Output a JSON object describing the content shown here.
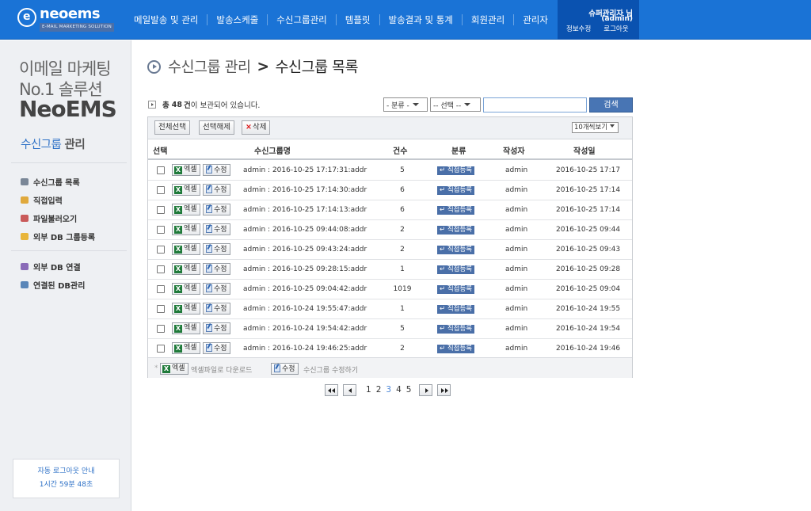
{
  "header": {
    "logo_name": "neoems",
    "logo_tagline": "E-MAIL MARKETING SOLUTION",
    "nav": [
      "메일발송 및 관리",
      "발송스케줄",
      "수신그룹관리",
      "템플릿",
      "발송결과 및 통계",
      "회원관리",
      "관리자"
    ],
    "user_name": "슈퍼관리자 님",
    "user_id": "(admin)",
    "edit_info": "정보수정",
    "logout": "로그아웃"
  },
  "sidebar": {
    "brand_line1": "이메일 마케팅",
    "brand_line2": "No.1 솔루션",
    "brand_line3": "NeoEMS",
    "section_title_a": "수신그룹",
    "section_title_b": "관리",
    "menu": [
      "수신그룹 목록",
      "직접입력",
      "파일불러오기",
      "외부 DB 그룹등록",
      "외부 DB 연결",
      "연결된 DB관리"
    ],
    "auto_logout_title": "자동 로그아웃 안내",
    "auto_logout_time": "1시간 59분 48초"
  },
  "breadcrumb": {
    "parent": "수신그룹 관리",
    "separator": ">",
    "current": "수신그룹 목록"
  },
  "summary": {
    "prefix": "총",
    "count": "48",
    "unit": "건",
    "suffix": "이 보관되어 있습니다."
  },
  "filters": {
    "category_select": "- 분류 -",
    "option_select": "-- 선택 --",
    "search_value": "",
    "search_button": "검색"
  },
  "toolbar": {
    "select_all": "전체선택",
    "deselect": "선택해제",
    "delete": "삭제",
    "page_size": "10개씩보기"
  },
  "table": {
    "headers": [
      "선택",
      "수신그룹명",
      "건수",
      "분류",
      "작성자",
      "작성일"
    ],
    "excel_label": "엑셀",
    "edit_label": "수정",
    "rows": [
      {
        "name": "admin : 2016-10-25 17:17:31:addr",
        "count": "5",
        "category": "직접등록",
        "author": "admin",
        "date": "2016-10-25 17:17"
      },
      {
        "name": "admin : 2016-10-25 17:14:30:addr",
        "count": "6",
        "category": "직접등록",
        "author": "admin",
        "date": "2016-10-25 17:14"
      },
      {
        "name": "admin : 2016-10-25 17:14:13:addr",
        "count": "6",
        "category": "직접등록",
        "author": "admin",
        "date": "2016-10-25 17:14"
      },
      {
        "name": "admin : 2016-10-25 09:44:08:addr",
        "count": "2",
        "category": "직접등록",
        "author": "admin",
        "date": "2016-10-25 09:44"
      },
      {
        "name": "admin : 2016-10-25 09:43:24:addr",
        "count": "2",
        "category": "직접등록",
        "author": "admin",
        "date": "2016-10-25 09:43"
      },
      {
        "name": "admin : 2016-10-25 09:28:15:addr",
        "count": "1",
        "category": "직접등록",
        "author": "admin",
        "date": "2016-10-25 09:28"
      },
      {
        "name": "admin : 2016-10-25 09:04:42:addr",
        "count": "1019",
        "category": "직접등록",
        "author": "admin",
        "date": "2016-10-25 09:04"
      },
      {
        "name": "admin : 2016-10-24 19:55:47:addr",
        "count": "1",
        "category": "직접등록",
        "author": "admin",
        "date": "2016-10-24 19:55"
      },
      {
        "name": "admin : 2016-10-24 19:54:42:addr",
        "count": "5",
        "category": "직접등록",
        "author": "admin",
        "date": "2016-10-24 19:54"
      },
      {
        "name": "admin : 2016-10-24 19:46:25:addr",
        "count": "2",
        "category": "직접등록",
        "author": "admin",
        "date": "2016-10-24 19:46"
      }
    ]
  },
  "legend": {
    "excel_desc": "엑셀파일로 다운로드",
    "edit_desc": "수신그룹 수정하기"
  },
  "pagination": {
    "pages": [
      "1",
      "2",
      "3",
      "4",
      "5"
    ],
    "current": "3"
  },
  "colors": {
    "header_bg": "#1a73d6",
    "accent": "#2f72c7",
    "tag_bg": "#4a6fa8",
    "search_btn": "#4875b4"
  }
}
